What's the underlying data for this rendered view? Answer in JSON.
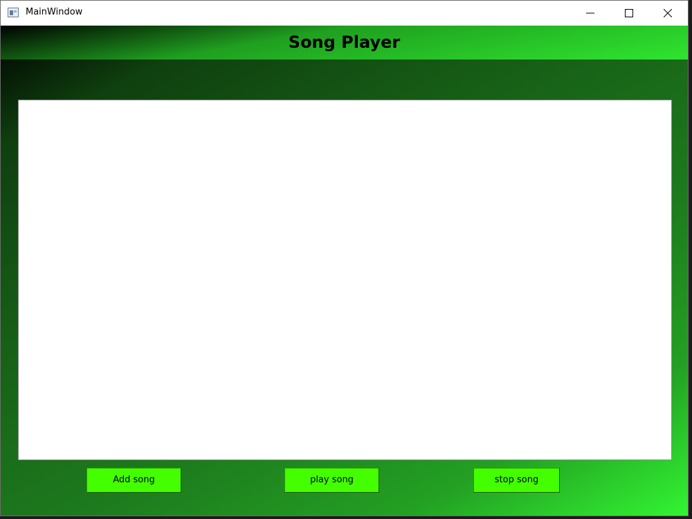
{
  "window": {
    "title": "MainWindow"
  },
  "header": {
    "title": "Song Player"
  },
  "song_list": {
    "items": []
  },
  "buttons": {
    "add_label": "Add song",
    "play_label": "play song",
    "stop_label": "stop song"
  },
  "icons": {
    "app": "app-window-icon",
    "minimize": "minimize-icon",
    "maximize": "maximize-icon",
    "close": "close-icon"
  },
  "colors": {
    "button_fill": "#44ff00",
    "gradient_dark": "#000000",
    "gradient_light": "#33f533",
    "list_background": "#ffffff"
  }
}
